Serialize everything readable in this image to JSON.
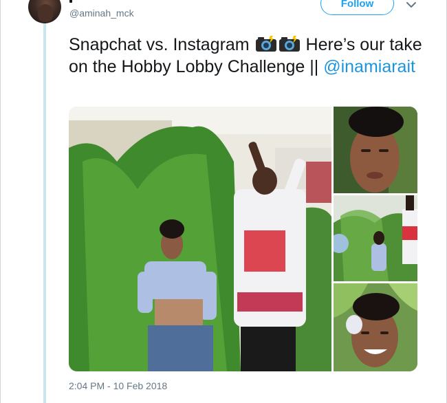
{
  "tweet": {
    "username": "@aminah_mck",
    "follow_label": "Follow",
    "text_part1": "Snapchat vs. Instagram",
    "text_part2": "Here’s our take on the Hobby Lobby Challenge ||",
    "mention": "@inamiarait",
    "timestamp": "2:04 PM - 10 Feb 2018"
  },
  "icons": {
    "avatar": "user-avatar",
    "menu": "chevron-down-icon",
    "emoji": "camera-with-flash-emoji"
  },
  "colors": {
    "accent": "#1da1f2",
    "mention": "#1b95e0",
    "thread_line": "#c8e6ef",
    "muted": "#657786"
  }
}
